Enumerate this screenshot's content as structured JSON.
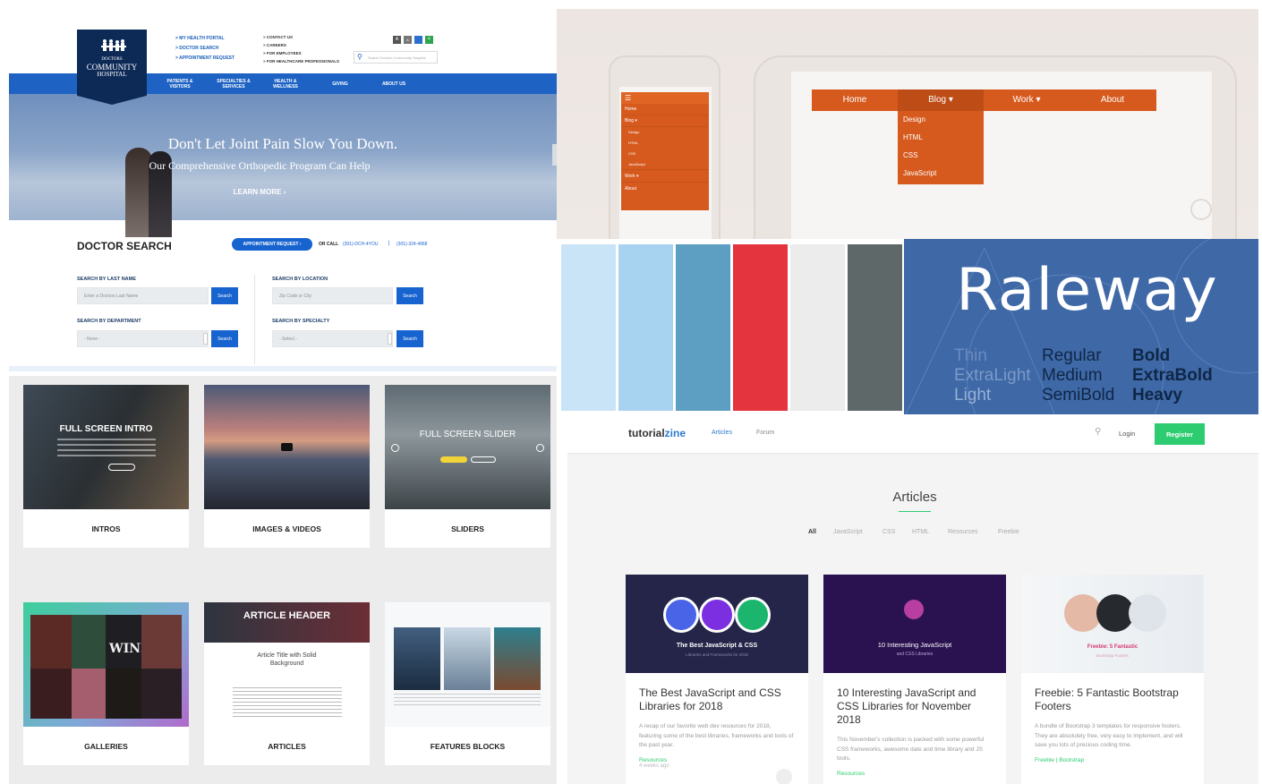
{
  "hospital": {
    "logo_line1": "DOCTORS",
    "logo_line2": "COMMUNITY",
    "logo_line3": "HOSPITAL",
    "quick_links": [
      "> MY HEALTH PORTAL",
      "> DOCTOR SEARCH",
      "> APPOINTMENT REQUEST"
    ],
    "secondary_links": [
      "> CONTACT US",
      "> CAREERS",
      "> FOR EMPLOYEES",
      "> FOR HEALTHCARE PROFESSIONALS"
    ],
    "search_placeholder": "Search Doctors Community Hospital",
    "nav": [
      {
        "line1": "PATIENTS &",
        "line2": "VISITORS"
      },
      {
        "line1": "SPECIALTIES &",
        "line2": "SERVICES"
      },
      {
        "line1": "HEALTH &",
        "line2": "WELLNESS"
      },
      {
        "line1": "GIVING",
        "line2": ""
      },
      {
        "line1": "ABOUT US",
        "line2": ""
      }
    ],
    "hero_title": "Don't Let Joint Pain Slow You Down.",
    "hero_subtitle": "Our Comprehensive Orthopedic Program Can Help",
    "hero_cta": "LEARN MORE ›",
    "doctor_search_title": "DOCTOR SEARCH",
    "appointment_button": "APPOINTMENT REQUEST ›",
    "or_call": "OR CALL",
    "phone1": "(301)-DCH-4YOU",
    "phone_sep": "|",
    "phone2": "(301)-324-4968",
    "last_name_label": "SEARCH BY LAST NAME",
    "last_name_placeholder": "Enter a Doctors Last Name",
    "location_label": "SEARCH BY LOCATION",
    "location_placeholder": "Zip Code or City",
    "department_label": "SEARCH BY DEPARTMENT",
    "department_value": "- None -",
    "specialty_label": "SEARCH BY SPECIALTY",
    "specialty_value": "- Select -",
    "search_button": "Search"
  },
  "menu_demo": {
    "desktop_items": [
      "Home",
      "Blog ▾",
      "Work ▾",
      "About"
    ],
    "dropdown_items": [
      "Design",
      "HTML",
      "CSS",
      "JavaScript"
    ],
    "mobile_items": [
      "Home",
      "Blog ▾",
      "Design",
      "HTML",
      "CSS",
      "JavaScript",
      "Work ▾",
      "About"
    ],
    "hamburger": "☰"
  },
  "palette": {
    "swatches": [
      "#c9e4f7",
      "#a7d3f1",
      "#5d9ec3",
      "#e4343d",
      "#ececec",
      "#5e6868"
    ]
  },
  "raleway": {
    "name": "Raleway",
    "weights_col1": [
      "Thin",
      "ExtraLight",
      "Light"
    ],
    "weights_col2": [
      "Regular",
      "Medium",
      "SemiBold"
    ],
    "weights_col3": [
      "Bold",
      "ExtraBold",
      "Heavy"
    ],
    "background": "#3e68a6"
  },
  "templates": {
    "cards": [
      {
        "caption": "INTROS",
        "overlay": "FULL SCREEN INTRO"
      },
      {
        "caption": "IMAGES & VIDEOS",
        "overlay": ""
      },
      {
        "caption": "SLIDERS",
        "overlay": "FULL SCREEN SLIDER"
      },
      {
        "caption": "GALLERIES",
        "overlay": "WINE"
      },
      {
        "caption": "ARTICLES",
        "overlay": "ARTICLE HEADER"
      },
      {
        "caption": "FEATURES BLOCKS",
        "overlay": ""
      }
    ],
    "article_subtitle": "Article Title with Solid Background"
  },
  "tutorialzine": {
    "logo_a": "tutorial",
    "logo_b": "zine",
    "nav_articles": "Articles",
    "nav_forum": "Forum",
    "login": "Login",
    "register": "Register",
    "page_title": "Articles",
    "filters": [
      "All",
      "JavaScript",
      "CSS",
      "HTML",
      "Resources",
      "Freebie"
    ],
    "accent": "#2ecc71",
    "articles": [
      {
        "cover_title": "The Best JavaScript & CSS",
        "cover_sub": "Libraries and Frameworks for 2018",
        "title": "The Best JavaScript and CSS Libraries for 2018",
        "desc": "A recap of our favorite web dev resources for 2018, featuring some of the best libraries, frameworks and tools of the past year.",
        "tag": "Resources",
        "time": "4 weeks ago"
      },
      {
        "cover_title": "10 Interesting JavaScript",
        "cover_sub": "and CSS Libraries",
        "title": "10 Interesting JavaScript and CSS Libraries for November 2018",
        "desc": "This November's collection is packed with some powerful CSS frameworks, awesome date and time library and JS tools.",
        "tag": "Resources",
        "time": ""
      },
      {
        "cover_title": "Freebie: 5 Fantastic",
        "cover_sub": "Bootstrap Footers",
        "title": "Freebie: 5 Fantastic Bootstrap Footers",
        "desc": "A bundle of Bootstrap 3 templates for responsive footers. They are absolutely free, very easy to implement, and will save you lots of precious coding time.",
        "tag": "Freebie | Bootstrap",
        "time": ""
      }
    ]
  }
}
